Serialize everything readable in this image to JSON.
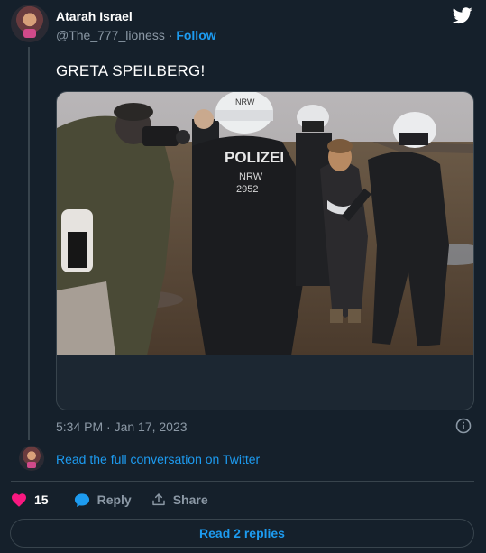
{
  "author": {
    "name": "Atarah Israel",
    "handle": "@The_777_lioness",
    "separator": "·",
    "follow_label": "Follow"
  },
  "tweet": {
    "text": "GRETA SPEILBERG!",
    "timestamp": "5:34 PM · Jan 17, 2023"
  },
  "media": {
    "description_icon": "video-still",
    "visible_text": {
      "helmet": "NRW",
      "vest_title": "POLIZEI",
      "vest_region": "NRW",
      "vest_number": "2952"
    }
  },
  "conversation": {
    "link_label": "Read the full conversation on Twitter"
  },
  "actions": {
    "like_count": "15",
    "reply_label": "Reply",
    "share_label": "Share"
  },
  "replies": {
    "button_label": "Read 2 replies"
  },
  "colors": {
    "background": "#15202b",
    "accent": "#1d9bf0",
    "like": "#f91880",
    "muted": "#8b98a5",
    "border": "#38444d"
  },
  "icons": [
    "twitter-bird-icon",
    "info-icon",
    "heart-icon",
    "reply-bubble-icon",
    "share-icon"
  ]
}
